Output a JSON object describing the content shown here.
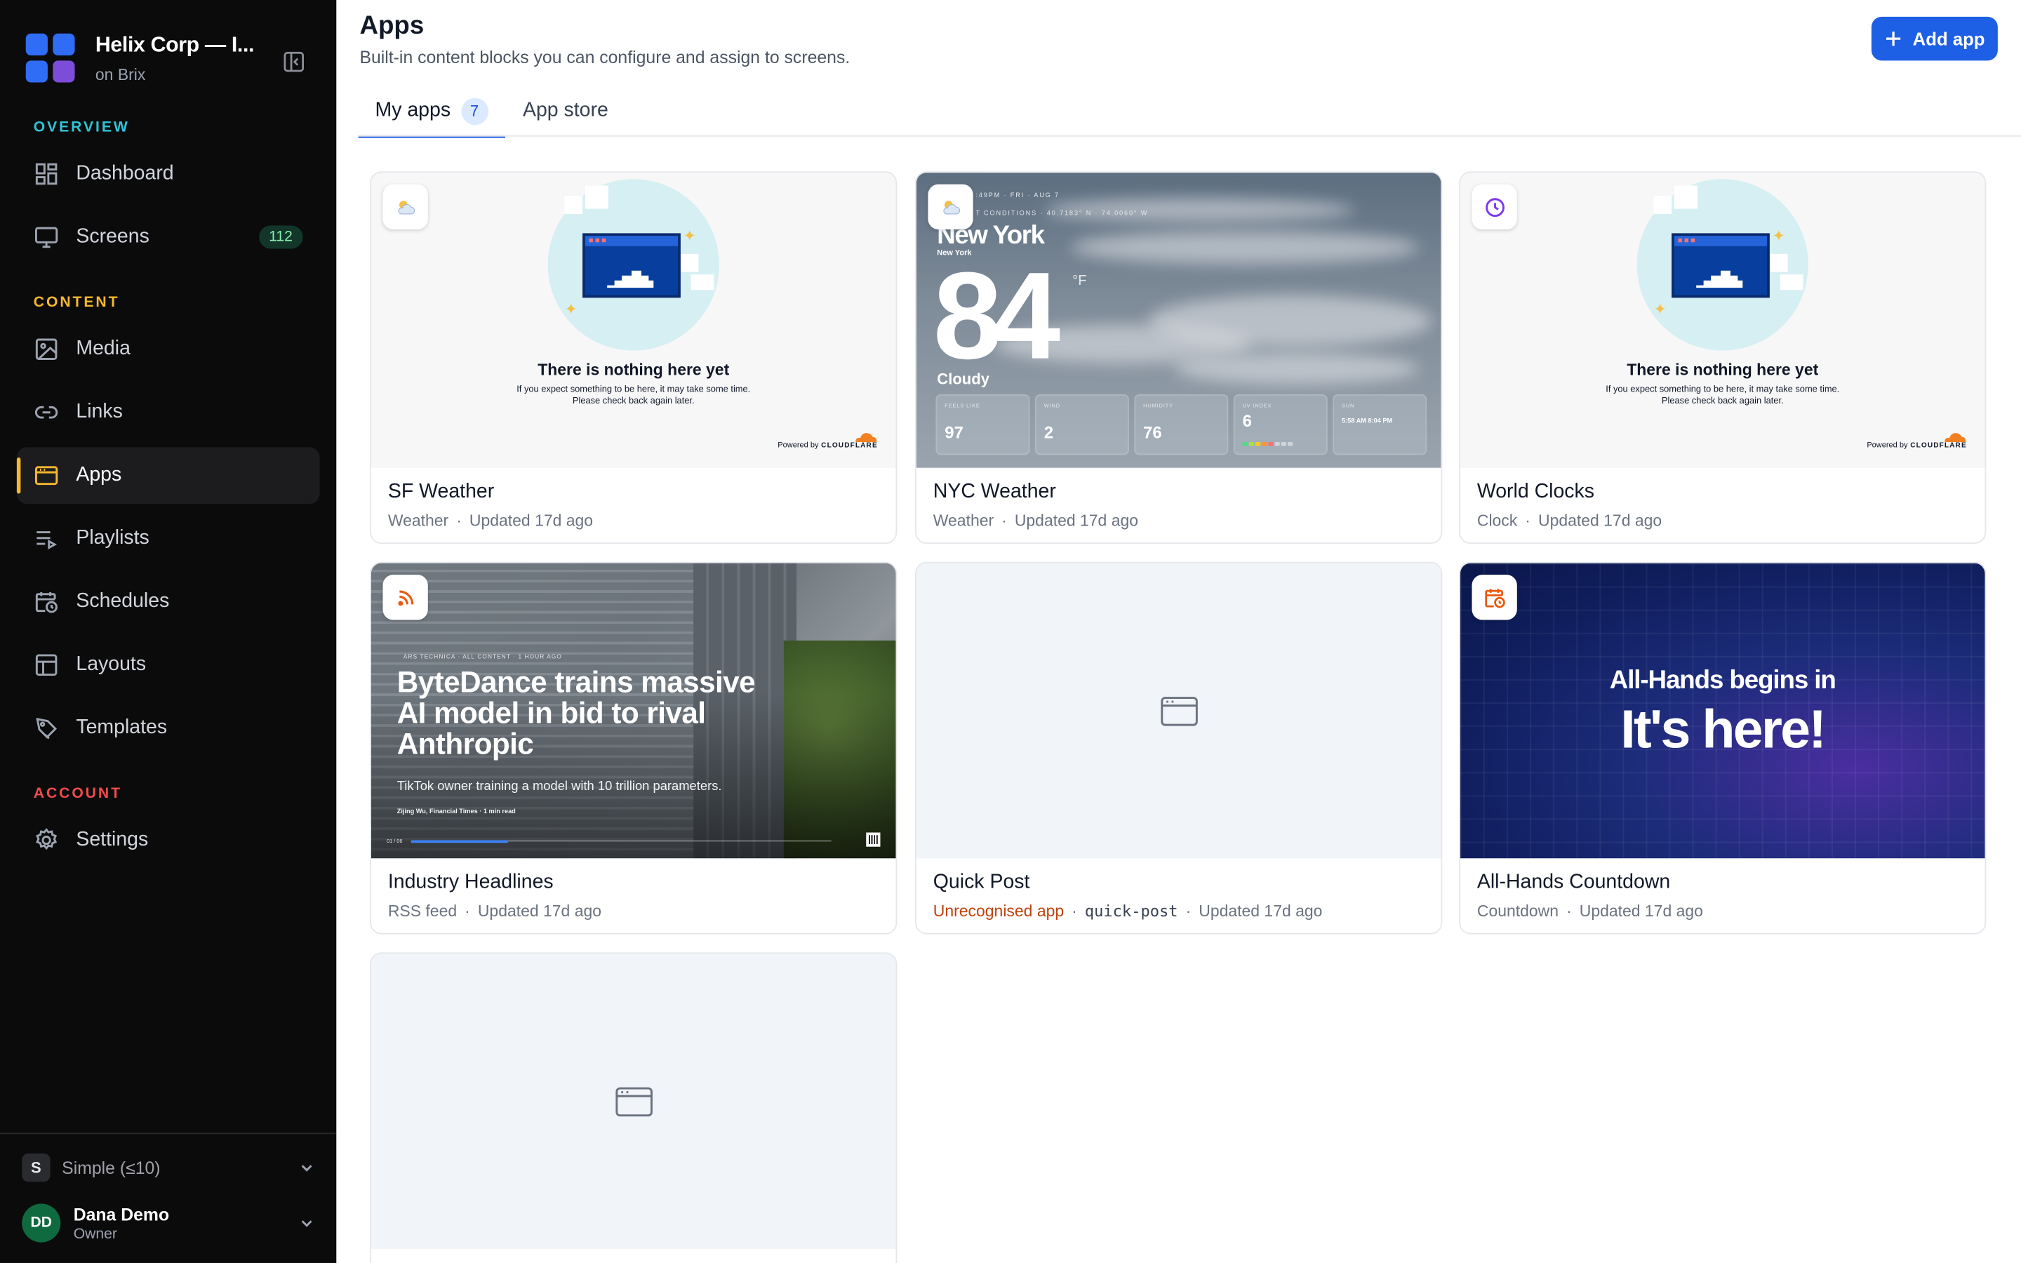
{
  "sidebar": {
    "workspace_name": "Helix Corp — I...",
    "workspace_sub": "on Brix",
    "brand_colors": [
      "#2f6df6",
      "#2f6df6",
      "#2f6df6",
      "#7c4dd8"
    ],
    "sections": {
      "overview": "OVERVIEW",
      "content": "CONTENT",
      "account": "ACCOUNT"
    },
    "section_colors": {
      "overview": "#2ec4d6",
      "content": "#f5b82e",
      "account": "#f04b4b"
    },
    "items": [
      {
        "label": "Dashboard",
        "icon": "dashboard-icon"
      },
      {
        "label": "Screens",
        "icon": "monitor-icon",
        "badge": "112"
      },
      {
        "label": "Media",
        "icon": "image-icon"
      },
      {
        "label": "Links",
        "icon": "link-icon"
      },
      {
        "label": "Apps",
        "icon": "app-window-icon",
        "active": true
      },
      {
        "label": "Playlists",
        "icon": "playlist-icon"
      },
      {
        "label": "Schedules",
        "icon": "calendar-clock-icon"
      },
      {
        "label": "Layouts",
        "icon": "layout-icon"
      },
      {
        "label": "Templates",
        "icon": "template-icon"
      },
      {
        "label": "Settings",
        "icon": "gear-icon"
      }
    ],
    "plan": {
      "letter": "S",
      "label": "Simple (≤10)"
    },
    "user": {
      "initials": "DD",
      "name": "Dana Demo",
      "role": "Owner"
    }
  },
  "header": {
    "title": "Apps",
    "subtitle": "Built-in content blocks you can configure and assign to screens.",
    "add_button": "Add app",
    "accent": "#1d5fe5"
  },
  "tabs": [
    {
      "label": "My apps",
      "count": "7",
      "active": true
    },
    {
      "label": "App store"
    }
  ],
  "cards": [
    {
      "name": "SF Weather",
      "type": "Weather",
      "updated": "Updated 17d ago",
      "icon": "weather-icon"
    },
    {
      "name": "NYC Weather",
      "type": "Weather",
      "updated": "Updated 17d ago",
      "icon": "weather-icon"
    },
    {
      "name": "World Clocks",
      "type": "Clock",
      "updated": "Updated 17d ago",
      "icon": "clock-icon"
    },
    {
      "name": "Industry Headlines",
      "type": "RSS feed",
      "updated": "Updated 17d ago",
      "icon": "rss-icon"
    },
    {
      "name": "Quick Post",
      "type": "Unrecognised app",
      "slug": "quick-post",
      "updated": "Updated 17d ago",
      "icon": "app-window-icon"
    },
    {
      "name": "All-Hands Countdown",
      "type": "Countdown",
      "updated": "Updated 17d ago",
      "icon": "calendar-clock-icon"
    },
    {
      "name": "",
      "type": "",
      "updated": "",
      "icon": "app-window-icon"
    }
  ],
  "empty_state": {
    "title": "There is nothing here yet",
    "line1": "If you expect something to be here, it may take some time.",
    "line2": "Please check back again later.",
    "powered_by": "Powered by",
    "brand": "CLOUDFLARE"
  },
  "nyc_preview": {
    "top": ":49PM · FRI · AUG 7",
    "conditions": "T CONDITIONS · 40.7183° N · 74.0060° W",
    "city": "New York",
    "city_small": "New York",
    "temp": "84",
    "unit": "°F",
    "desc": "Cloudy",
    "tiles": [
      {
        "label": "FEELS LIKE",
        "value": "97"
      },
      {
        "label": "WIND",
        "value": "2"
      },
      {
        "label": "HUMIDITY",
        "value": "76"
      },
      {
        "label": "UV INDEX",
        "value": "6"
      },
      {
        "label": "SUN",
        "value": "5:58 AM  8:04 PM"
      }
    ]
  },
  "news_preview": {
    "source": "ARS TECHNICA · ALL CONTENT · 1 HOUR AGO",
    "headline": "ByteDance trains massive AI model in bid to rival Anthropic",
    "sub": "TikTok owner training a model with 10 trillion parameters.",
    "author": "Zijing Wu, Financial Times  ·  1 min read",
    "time": "01 / 06",
    "progress": 0.23
  },
  "countdown_preview": {
    "title": "All-Hands begins in",
    "big": "It's here!"
  }
}
